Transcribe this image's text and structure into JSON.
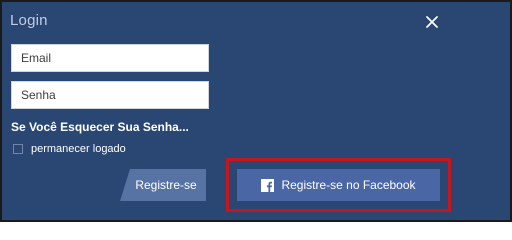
{
  "dialog": {
    "title": "Login"
  },
  "form": {
    "email_placeholder": "Email",
    "password_placeholder": "Senha",
    "forgot_password": "Se Você Esquecer Sua Senha...",
    "remember_label": "permanecer logado"
  },
  "actions": {
    "register_label": "Registre-se",
    "facebook_register_label": "Registre-se no Facebook"
  },
  "icons": {
    "close": "close-icon",
    "facebook": "facebook-icon"
  },
  "colors": {
    "panel_background": "#2a4672",
    "register_button": "#5673a4",
    "facebook_button": "#4a66a5",
    "highlight_border": "#c4161c"
  }
}
